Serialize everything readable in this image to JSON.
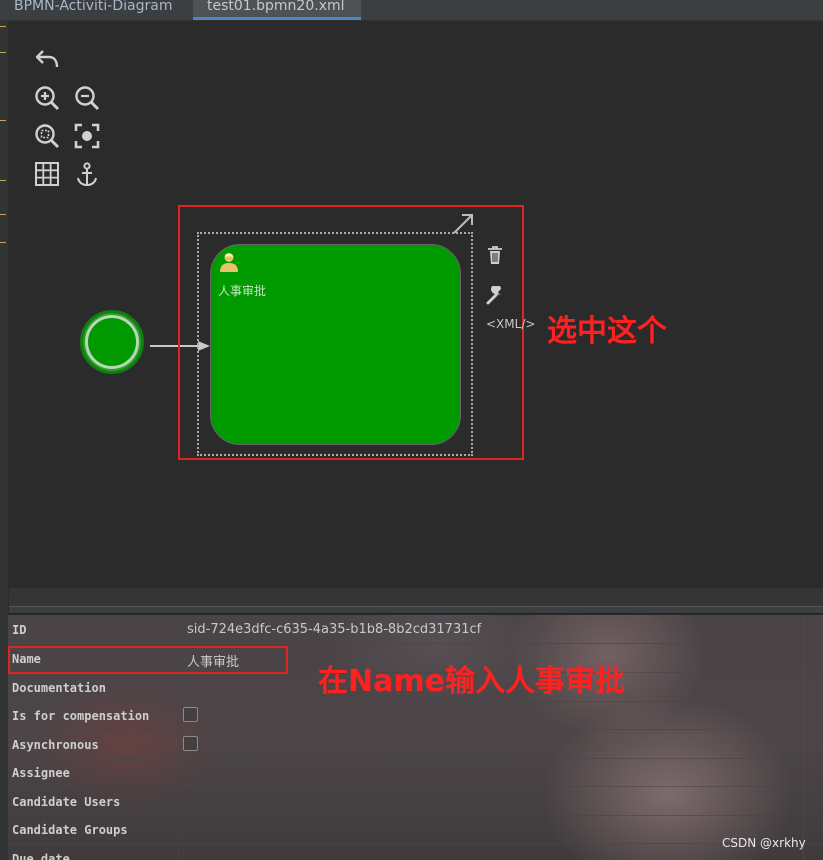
{
  "tabs": [
    {
      "label": "BPMN-Activiti-Diagram"
    },
    {
      "label": "test01.bpmn20.xml"
    }
  ],
  "toolbar": {
    "icons": [
      "undo-icon",
      "zoom-in-icon",
      "zoom-out-icon",
      "zoom-fit-icon",
      "zoom-actual-icon",
      "grid-icon",
      "anchor-icon"
    ]
  },
  "diagram": {
    "task_label": "人事审批",
    "xml_link": "<XML/>"
  },
  "annotations": {
    "select_this": "选中这个",
    "enter_name": "在Name输入人事审批"
  },
  "properties": [
    {
      "label": "ID",
      "value": "sid-724e3dfc-c635-4a35-b1b8-8b2cd31731cf",
      "type": "text"
    },
    {
      "label": "Name",
      "value": "人事审批",
      "type": "text"
    },
    {
      "label": "Documentation",
      "value": "",
      "type": "text"
    },
    {
      "label": "Is for compensation",
      "value": "",
      "type": "checkbox"
    },
    {
      "label": "Asynchronous",
      "value": "",
      "type": "checkbox"
    },
    {
      "label": "Assignee",
      "value": "",
      "type": "text"
    },
    {
      "label": "Candidate Users",
      "value": "",
      "type": "text"
    },
    {
      "label": "Candidate Groups",
      "value": "",
      "type": "text"
    },
    {
      "label": "Due date",
      "value": "",
      "type": "text"
    }
  ],
  "watermark": "CSDN @xrkhy",
  "colors": {
    "task_fill": "#009900",
    "highlight": "#e02424"
  }
}
